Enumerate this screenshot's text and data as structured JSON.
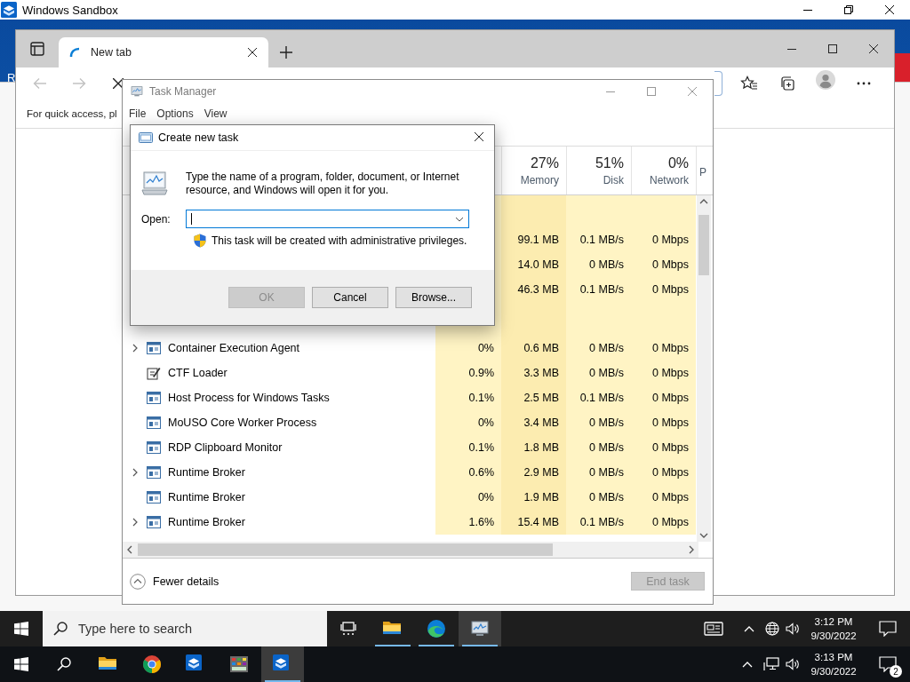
{
  "host_window": {
    "title": "Windows Sandbox"
  },
  "desktop": {
    "icon_label": "R"
  },
  "browser": {
    "tab": {
      "title": "New tab",
      "selected": true
    },
    "page_text": "For quick access, pl"
  },
  "task_manager": {
    "title": "Task Manager",
    "menu": [
      "File",
      "Options",
      "View"
    ],
    "columns": [
      {
        "percent": "27%",
        "label": "Memory"
      },
      {
        "percent": "51%",
        "label": "Disk"
      },
      {
        "percent": "0%",
        "label": "Network"
      },
      {
        "label": "P"
      }
    ],
    "app_rows": [
      {
        "memory": "99.1 MB",
        "disk": "0.1 MB/s",
        "network": "0 Mbps"
      },
      {
        "memory": "14.0 MB",
        "disk": "0 MB/s",
        "network": "0 Mbps"
      },
      {
        "memory": "46.3 MB",
        "disk": "0.1 MB/s",
        "network": "0 Mbps"
      }
    ],
    "background_rows": [
      {
        "name": "Container Execution Agent",
        "kind": "window",
        "expandable": true,
        "cpu": "0%",
        "memory": "0.6 MB",
        "disk": "0 MB/s",
        "network": "0 Mbps"
      },
      {
        "name": "CTF Loader",
        "kind": "pen",
        "expandable": false,
        "cpu": "0.9%",
        "memory": "3.3 MB",
        "disk": "0 MB/s",
        "network": "0 Mbps"
      },
      {
        "name": "Host Process for Windows Tasks",
        "kind": "window",
        "expandable": false,
        "cpu": "0.1%",
        "memory": "2.5 MB",
        "disk": "0.1 MB/s",
        "network": "0 Mbps"
      },
      {
        "name": "MoUSO Core Worker Process",
        "kind": "window",
        "expandable": false,
        "cpu": "0%",
        "memory": "3.4 MB",
        "disk": "0 MB/s",
        "network": "0 Mbps"
      },
      {
        "name": "RDP Clipboard Monitor",
        "kind": "window",
        "expandable": false,
        "cpu": "0.1%",
        "memory": "1.8 MB",
        "disk": "0 MB/s",
        "network": "0 Mbps"
      },
      {
        "name": "Runtime Broker",
        "kind": "window",
        "expandable": true,
        "cpu": "0.6%",
        "memory": "2.9 MB",
        "disk": "0 MB/s",
        "network": "0 Mbps"
      },
      {
        "name": "Runtime Broker",
        "kind": "window",
        "expandable": false,
        "cpu": "0%",
        "memory": "1.9 MB",
        "disk": "0 MB/s",
        "network": "0 Mbps"
      },
      {
        "name": "Runtime Broker",
        "kind": "window",
        "expandable": true,
        "cpu": "1.6%",
        "memory": "15.4 MB",
        "disk": "0.1 MB/s",
        "network": "0 Mbps"
      }
    ],
    "fewer_details": "Fewer details",
    "end_task": {
      "label": "End task",
      "disabled": true
    }
  },
  "dialog": {
    "title": "Create new task",
    "description": "Type the name of a program, folder, document, or Internet resource, and Windows will open it for you.",
    "open_label": "Open:",
    "admin_note": "This task will be created with administrative privileges.",
    "buttons": [
      {
        "label": "OK",
        "disabled": true
      },
      {
        "label": "Cancel",
        "disabled": false
      },
      {
        "label": "Browse...",
        "disabled": false
      }
    ]
  },
  "sandbox_taskbar": {
    "search_placeholder": "Type here to search",
    "apps": [
      {
        "kind": "explorer",
        "selected": false
      },
      {
        "kind": "edge",
        "selected": false
      },
      {
        "kind": "taskmgr",
        "selected": true
      }
    ],
    "time": "3:12 PM",
    "date": "9/30/2022"
  },
  "host_taskbar": {
    "apps": [
      {
        "kind": "explorer",
        "selected": false
      },
      {
        "kind": "chrome",
        "selected": false
      },
      {
        "kind": "sandbox",
        "selected": false
      },
      {
        "kind": "grid",
        "selected": false
      },
      {
        "kind": "sandbox",
        "selected": true
      }
    ],
    "time": "3:13 PM",
    "date": "9/30/2022",
    "notification_count": "2"
  }
}
